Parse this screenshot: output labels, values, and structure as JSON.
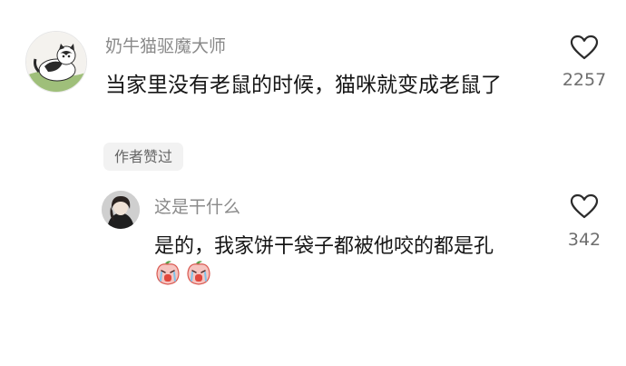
{
  "comment": {
    "username": "奶牛猫驱魔大师",
    "text": "当家里没有老鼠的时候，猫咪就变成老鼠了",
    "like_count": "2257",
    "avatar_icon": "cow-cat-avatar",
    "like_icon": "heart-outline-icon"
  },
  "author_badge": "作者赞过",
  "reply": {
    "username": "这是干什么",
    "text": "是的，我家饼干袋子都被他咬的都是孔",
    "like_count": "342",
    "emojis": [
      "crying-peach-emoji",
      "crying-peach-emoji"
    ],
    "avatar_icon": "person-avatar",
    "like_icon": "heart-outline-icon"
  },
  "colors": {
    "username": "#8a8a8a",
    "text": "#161616",
    "count": "#6e6e6e",
    "badge_bg": "#f2f2f2"
  }
}
